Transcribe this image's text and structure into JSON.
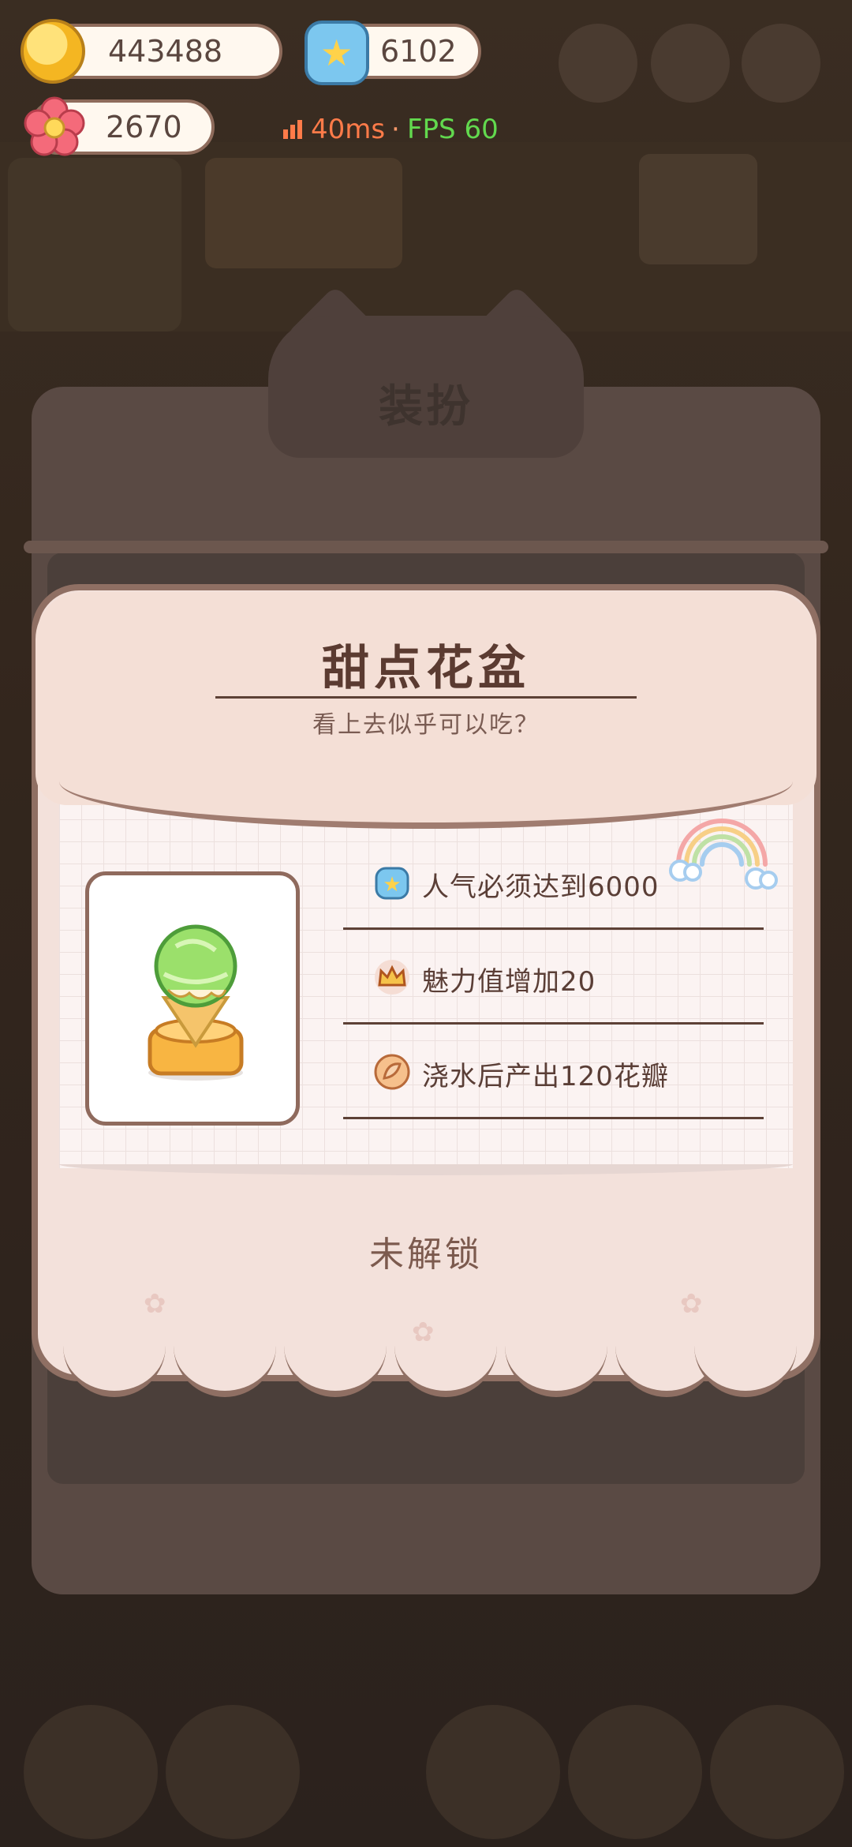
{
  "hud": {
    "coins": "443488",
    "popularity": "6102",
    "petals": "2670",
    "ping": "40ms",
    "separator": "·",
    "fps": "FPS 60"
  },
  "background_panel": {
    "title": "装扮"
  },
  "modal": {
    "title": "甜点花盆",
    "subtitle": "看上去似乎可以吃？",
    "attributes": [
      {
        "icon": "popularity-jar-icon",
        "label": "人气必须达到6000"
      },
      {
        "icon": "crown-icon",
        "label": "魅力值增加20"
      },
      {
        "icon": "petal-icon",
        "label": "浇水后产出120花瓣"
      }
    ],
    "status": "未解锁"
  },
  "colors": {
    "accent_brown": "#8f6f63",
    "panel_bg": "#f3e1db",
    "title_text": "#5b3b31",
    "ping": "#ff7b49",
    "fps": "#62d94e"
  }
}
